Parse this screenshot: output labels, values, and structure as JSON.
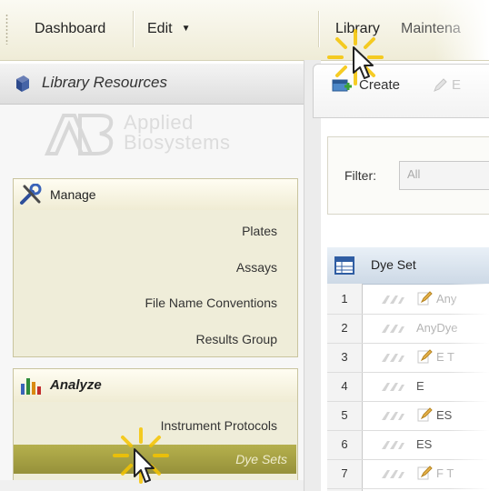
{
  "menubar": {
    "items": [
      "Dashboard",
      "Edit",
      "Library",
      "Maintena"
    ],
    "edit_caret": "▼"
  },
  "left_panel": {
    "title": "Library Resources",
    "logo": {
      "line1": "Applied",
      "line2": "Biosystems"
    },
    "manage": {
      "title": "Manage",
      "items": [
        "Plates",
        "Assays",
        "File Name Conventions",
        "Results Group"
      ]
    },
    "analyze": {
      "title": "Analyze",
      "items": [
        "Instrument Protocols",
        "Dye Sets"
      ]
    }
  },
  "toolbar": {
    "create_label": "Create",
    "next_label": "E"
  },
  "filter": {
    "label": "Filter:",
    "value": "All"
  },
  "grid": {
    "header": "Dye Set",
    "rows": [
      {
        "num": "1",
        "text": "Any",
        "edit": true,
        "faded": true
      },
      {
        "num": "2",
        "text": "AnyDye",
        "edit": false,
        "faded": true
      },
      {
        "num": "3",
        "text": "E T",
        "edit": true,
        "faded": true
      },
      {
        "num": "4",
        "text": "E",
        "edit": false,
        "faded": false
      },
      {
        "num": "5",
        "text": "ES",
        "edit": true,
        "faded": false
      },
      {
        "num": "6",
        "text": "ES",
        "edit": false,
        "faded": false
      },
      {
        "num": "7",
        "text": "F T",
        "edit": true,
        "faded": true
      }
    ]
  },
  "colors": {
    "menubar_bg": "#f3f0dd",
    "section_bg": "#efedd9",
    "selected_item": "#a6a145",
    "highlight_spark": "#f5c400",
    "grid_header": "#d6e1ec"
  }
}
